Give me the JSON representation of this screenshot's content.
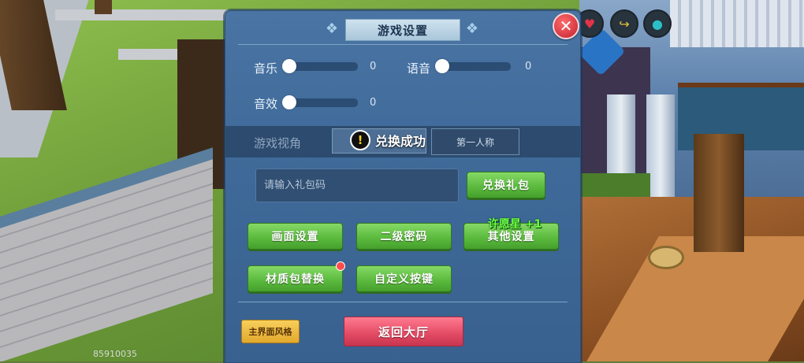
{
  "scene": {
    "counter_text": "85910035"
  },
  "top_icons": [
    {
      "icon": "heart-icon",
      "glyph": "♥",
      "color": "#e2334a"
    },
    {
      "icon": "share-icon",
      "glyph": "↪",
      "color": "#e8c13a"
    },
    {
      "icon": "drop-icon",
      "glyph": "●",
      "color": "#2bc0c8"
    }
  ],
  "dialog": {
    "title": "游戏设置",
    "close_glyph": "✕",
    "volume": {
      "music": {
        "label": "音乐",
        "value_text": "0",
        "level": 0
      },
      "voice": {
        "label": "语音",
        "value_text": "0",
        "level": 0
      },
      "sfx": {
        "label": "音效",
        "value_text": "0",
        "level": 0
      }
    },
    "view": {
      "label": "游戏视角",
      "option_2": "第一人称",
      "toast_icon": "!",
      "toast_text": "兑换成功"
    },
    "gift": {
      "placeholder": "请输入礼包码",
      "redeem_label": "兑换礼包"
    },
    "buttons": {
      "graphics": "画面设置",
      "second_password": "二级密码",
      "other_settings": "其他设置",
      "texture_pack": "材质包替换",
      "custom_keys": "自定义按键"
    },
    "floating_text": "许愿星 +1",
    "main_style": "主界面风格",
    "return_lobby": "返回大厅"
  },
  "colors": {
    "green_button": "#5cbb3f",
    "red_button": "#e24a63",
    "gold_button": "#e2a92d",
    "close_button": "#c2202f",
    "dialog_bg": "#3f6a99"
  }
}
